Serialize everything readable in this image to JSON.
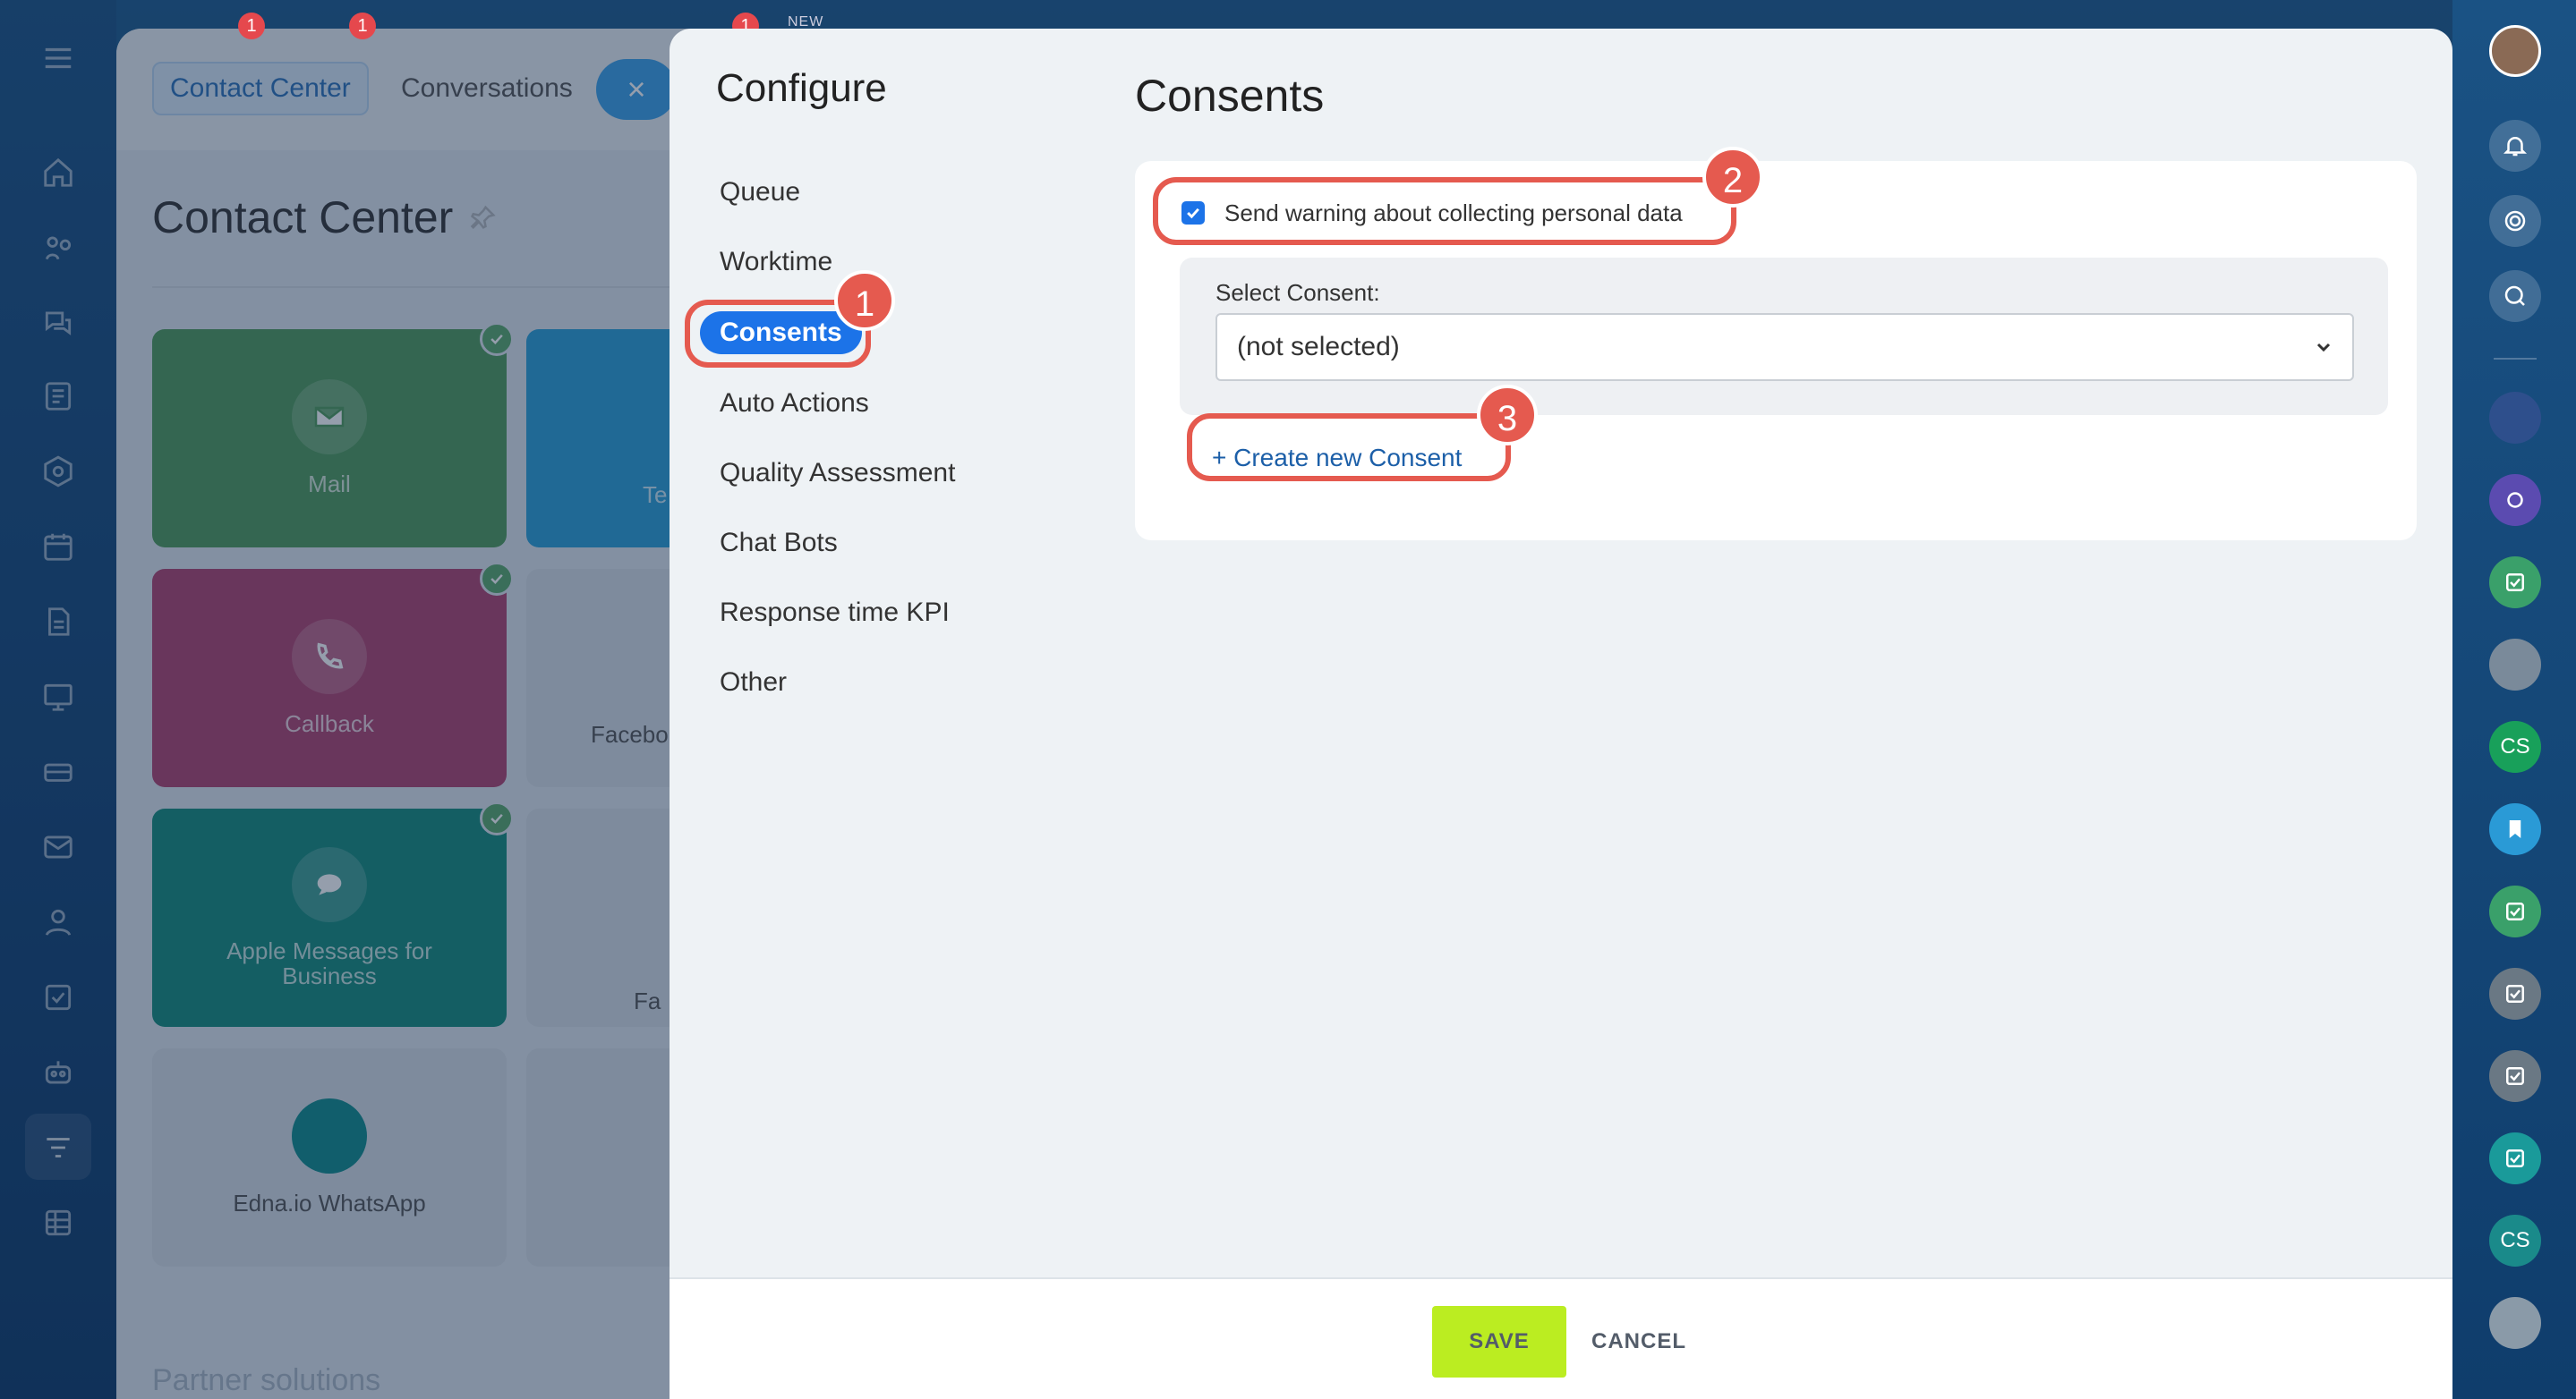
{
  "background": {
    "tabs": {
      "contact_center": "Contact Center",
      "conversations": "Conversations",
      "close": "×"
    },
    "title": "Contact Center",
    "tiles": [
      {
        "label": "Mail"
      },
      {
        "label": "Te"
      },
      {
        "label": "Callback"
      },
      {
        "label": "Facebo"
      },
      {
        "label": "Apple Messages for Business"
      },
      {
        "label": "Fa"
      },
      {
        "label": "Edna.io WhatsApp"
      }
    ],
    "bottom_text": "Partner solutions",
    "header_badges": [
      "1",
      "1",
      "1"
    ],
    "new_label": "NEW"
  },
  "configure": {
    "title": "Configure",
    "menu": [
      "Queue",
      "Worktime",
      "Consents",
      "Auto Actions",
      "Quality Assessment",
      "Chat Bots",
      "Response time KPI",
      "Other"
    ],
    "active": "Consents"
  },
  "consents": {
    "heading": "Consents",
    "checkbox_label": "Send warning about collecting personal data",
    "checkbox_checked": true,
    "select_label": "Select Consent:",
    "select_value": "(not selected)",
    "create_link": "+ Create new Consent"
  },
  "annotations": [
    "1",
    "2",
    "3"
  ],
  "footer": {
    "save": "SAVE",
    "cancel": "CANCEL"
  },
  "right_rail": {
    "cs_1": "CS",
    "cs_2": "CS"
  },
  "colors": {
    "accent": "#1c73e8",
    "save": "#bbed21",
    "highlight": "#e55a4f"
  }
}
